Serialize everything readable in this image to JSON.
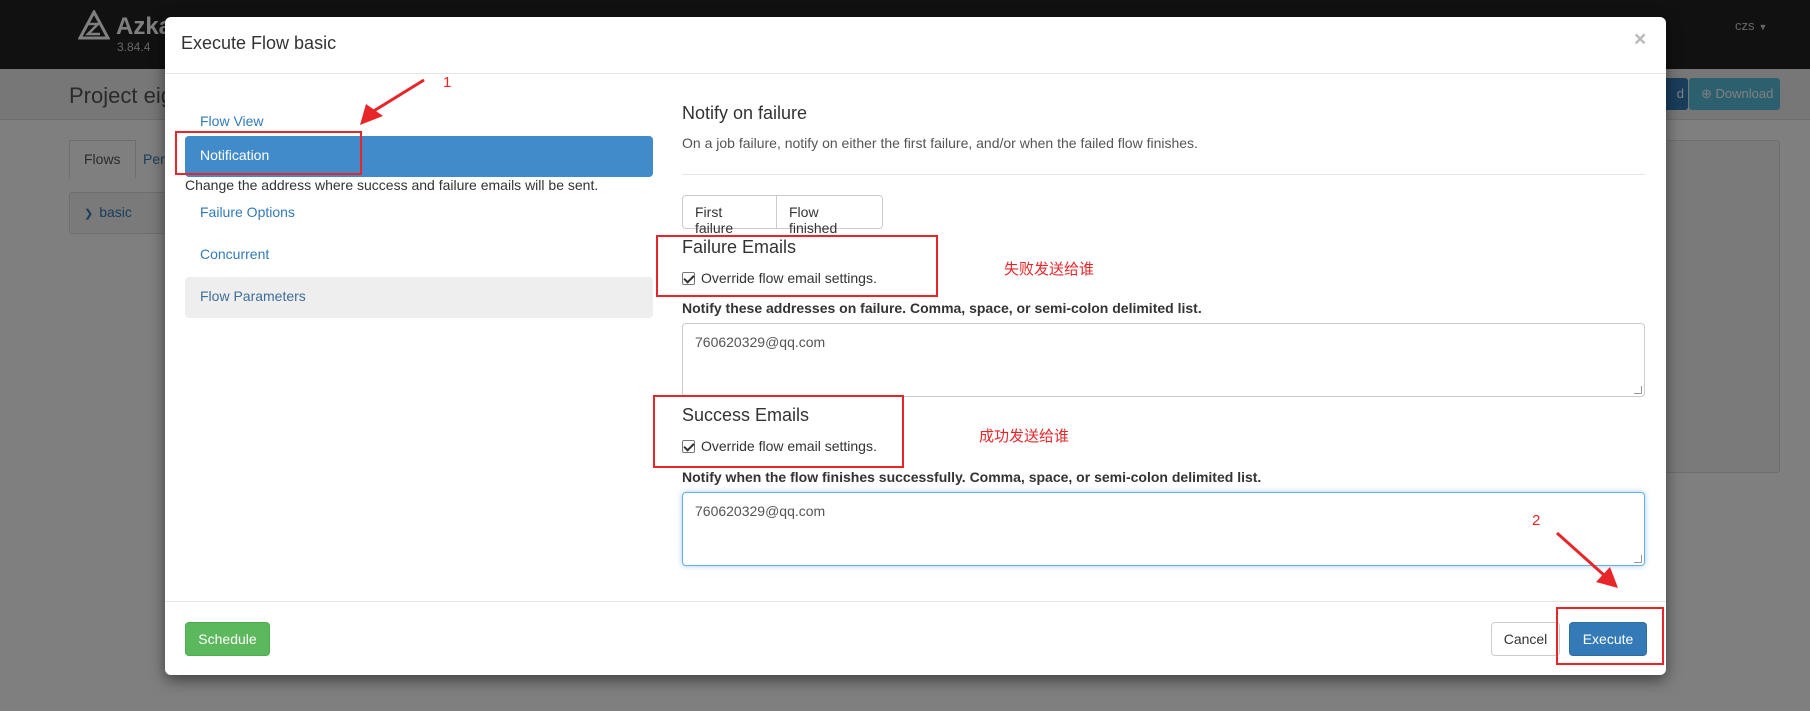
{
  "app": {
    "logo_text": "Azka",
    "version": "3.84.4",
    "user": "czs",
    "project_title": "Project eig",
    "header_buttons": {
      "primary_label": "d",
      "download_label": "Download"
    },
    "tabs": [
      {
        "label": "Flows"
      },
      {
        "label": "Per"
      }
    ],
    "flow_item": "basic"
  },
  "modal": {
    "title": "Execute Flow basic",
    "close_symbol": "×",
    "sidebar": {
      "items": [
        {
          "label": "Flow View"
        },
        {
          "label": "Notification",
          "active": true
        },
        {
          "label": "Failure Options"
        },
        {
          "label": "Concurrent"
        },
        {
          "label": "Flow Parameters"
        }
      ],
      "notification_desc": "Change the address where success and failure emails will be sent."
    },
    "notify": {
      "title": "Notify on failure",
      "description": "On a job failure, notify on either the first failure, and/or when the failed flow finishes.",
      "first_failure_label": "First failure",
      "flow_finished_label": "Flow finished"
    },
    "failure_emails": {
      "title": "Failure Emails",
      "override_label": "Override flow email settings.",
      "override_checked": true,
      "list_label": "Notify these addresses on failure. Comma, space, or semi-colon delimited list.",
      "value": "760620329@qq.com"
    },
    "success_emails": {
      "title": "Success Emails",
      "override_label": "Override flow email settings.",
      "override_checked": true,
      "list_label": "Notify when the flow finishes successfully. Comma, space, or semi-colon delimited list.",
      "value": "760620329@qq.com"
    },
    "footer": {
      "schedule_label": "Schedule",
      "cancel_label": "Cancel",
      "execute_label": "Execute"
    }
  },
  "annotations": {
    "step_1": "1",
    "step_2": "2",
    "failure_note": "失败发送给谁",
    "success_note": "成功发送给谁",
    "color": "#e8262a"
  },
  "colors": {
    "primary": "#337ab7",
    "active_item": "#428bca",
    "success": "#5cb85c",
    "navbar": "#222222"
  }
}
